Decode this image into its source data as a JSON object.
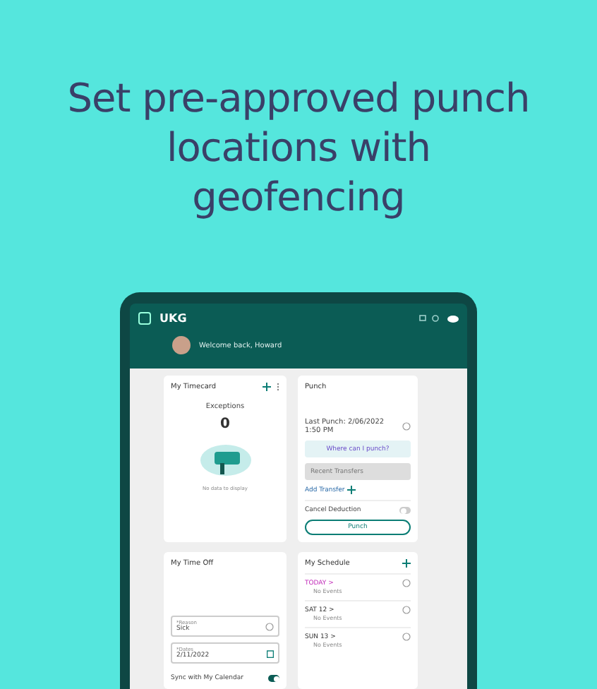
{
  "headline": "Set pre-approved punch locations with geofencing",
  "app": {
    "logo": "UKG",
    "welcome": "Welcome back, Howard"
  },
  "timecard": {
    "title": "My Timecard",
    "exceptions_label": "Exceptions",
    "exceptions_count": "0",
    "empty_text": "No data to display"
  },
  "punch": {
    "title": "Punch",
    "last_punch": "Last Punch: 2/06/2022 1:50 PM",
    "map_label": "Where can I punch?",
    "transfer_placeholder": "Recent Transfers",
    "add_transfer": "Add Transfer",
    "cancel_deduction": {
      "label": "Cancel Deduction",
      "on": false
    },
    "button": "Punch"
  },
  "time_off": {
    "title": "My Time Off",
    "reason": {
      "label": "*Reason",
      "value": "Sick"
    },
    "dates": {
      "label": "*Dates",
      "value": "2/11/2022"
    },
    "sync": {
      "label": "Sync with My Calendar",
      "on": true
    }
  },
  "schedule": {
    "title": "My Schedule",
    "days": [
      {
        "day": "TODAY >",
        "today": true,
        "events": "No Events"
      },
      {
        "day": "SAT 12 >",
        "today": false,
        "events": "No Events"
      },
      {
        "day": "SUN 13 >",
        "today": false,
        "events": "No Events"
      }
    ]
  }
}
